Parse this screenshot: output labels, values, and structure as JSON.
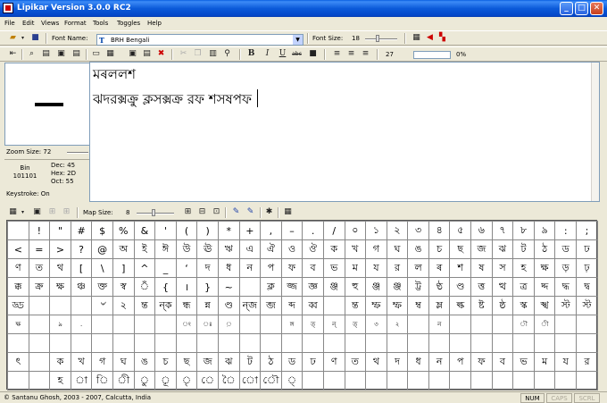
{
  "window": {
    "title": "Lipikar Version 3.0.0 RC2"
  },
  "menu": [
    "File",
    "Edit",
    "Views",
    "Format",
    "Tools",
    "Toggles",
    "Help"
  ],
  "toolbar1": {
    "font_name_label": "Font Name:",
    "font_name_value": "BRH Bengali",
    "font_size_label": "Font Size:",
    "font_size_value": "18"
  },
  "toolbar2": {
    "char_count": "27",
    "progress_label": "0%",
    "progress_value": 0
  },
  "left_panel": {
    "zoom_label": "Zoom Size:",
    "zoom_value": "72",
    "bin_label": "Bin",
    "bin_value": "101101",
    "dec": "Dec: 45",
    "hex": "Hex: 2D",
    "oct": "Oct: 55",
    "keystroke": "Keystroke: On"
  },
  "editor": {
    "line1": "মৰললশ",
    "line2": "ঝদরক্সক্রু ক্লসক্সক্র রফ শসষপফ"
  },
  "map_toolbar": {
    "map_size_label": "Map Size:",
    "map_size_value": "8"
  },
  "char_map": {
    "rows": [
      [
        "",
        "!",
        "\"",
        "#",
        "$",
        "%",
        "&",
        "'",
        "(",
        ")",
        "*",
        "+",
        ",",
        "–",
        ".",
        "/",
        "০",
        "১",
        "২",
        "৩",
        "৪",
        "৫",
        "৬",
        "৭",
        "৮",
        "৯",
        ":",
        ";"
      ],
      [
        "<",
        "=",
        ">",
        "?",
        "@",
        "অ",
        "ই",
        "ঈ",
        "উ",
        "ঊ",
        "ঋ",
        "এ",
        "ঐ",
        "ও",
        "ঔ",
        "ক",
        "খ",
        "গ",
        "ঘ",
        "ঙ",
        "চ",
        "ছ",
        "জ",
        "ঝ",
        "ট",
        "ঠ",
        "ড",
        "ঢ"
      ],
      [
        "ণ",
        "ত",
        "থ",
        "[",
        "\\",
        "]",
        "^",
        "_",
        "‘",
        "দ",
        "ধ",
        "ন",
        "প",
        "ফ",
        "ব",
        "ভ",
        "ম",
        "য",
        "র",
        "ল",
        "ৰ",
        "শ",
        "ষ",
        "স",
        "হ",
        "ক্ষ",
        "ড়",
        "ঢ়"
      ],
      [
        "ক্ক",
        "ক্র",
        "ক্ষ",
        "ঞ্চ",
        "ক্ত",
        "স্ব",
        "ঁ",
        "{",
        "।",
        "}",
        "~",
        "",
        "ক্ল",
        "জ্জ",
        "জ্ঞ",
        "ঞ্জ",
        "হু",
        "ঞ্জ",
        "ঞ্জ",
        "ট্ট",
        "ণ্ঠ",
        "ণ্ড",
        "ত্ত",
        "ত্থ",
        "ত্র",
        "দ্দ",
        "দ্ধ",
        "দ্ব"
      ],
      [
        "ড্ড",
        "",
        "",
        "",
        "৺",
        "২",
        "ন্ত",
        "ন্ক",
        "ন্ধ",
        "ন্ন",
        "ণ্ড",
        "ন্জ",
        "ব্জ",
        "ব্দ",
        "ব্ব",
        "",
        "ন্ত",
        "ম্ফ",
        "ম্ফ",
        "ম্ব",
        "ম্ল",
        "ল্ক",
        "ষ্ট",
        "ষ্ঠ",
        "স্ক",
        "স্খ",
        "স্ট",
        "স্ট"
      ],
      [
        "ক্ষ",
        "",
        "৯",
        ".",
        "",
        "",
        "",
        "",
        "ং",
        "ঃ",
        "়",
        "",
        "",
        "ঙ্গ",
        "ত্",
        "ন্",
        "ত্",
        "৩",
        "২",
        "",
        "ন",
        "",
        "",
        "",
        "ৗ",
        "ী",
        "",
        ""
      ],
      [
        "",
        "",
        "",
        "",
        "",
        "",
        "",
        "",
        "",
        "",
        "",
        "",
        "",
        "",
        "",
        "",
        "",
        "",
        "",
        "",
        "",
        "",
        "",
        "",
        "",
        "",
        "",
        ""
      ],
      [
        "ৎ",
        "",
        "ক",
        "খ",
        "গ",
        "ঘ",
        "ঙ",
        "চ",
        "ছ",
        "জ",
        "ঝ",
        "ট",
        "ঠ",
        "ড",
        "ঢ",
        "ণ",
        "ত",
        "থ",
        "দ",
        "ধ",
        "ন",
        "প",
        "ফ",
        "ব",
        "ভ",
        "ম",
        "য",
        "র"
      ],
      [
        "",
        "",
        "হ",
        "া",
        "ি",
        "ী",
        "ু",
        "ূ",
        "ৃ",
        "ে",
        "ৈ",
        "ো",
        "ৌ",
        "্",
        "",
        "",
        "",
        "",
        "",
        "",
        "",
        "",
        "",
        "",
        "",
        "",
        "",
        ""
      ]
    ]
  },
  "status": {
    "copyright": "© Santanu Ghosh, 2003 - 2007, Calcutta, India",
    "num": "NUM",
    "caps": "CAPS",
    "scrl": "SCRL"
  }
}
